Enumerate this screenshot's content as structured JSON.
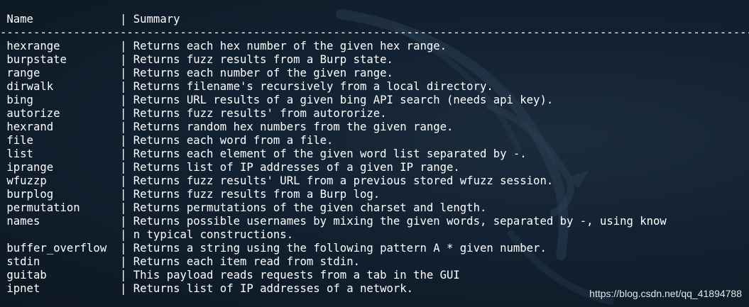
{
  "terminal": {
    "lines": [
      " Name             | Summary",
      "-----------------------------------------------------------------------------------------------------------------------",
      " hexrange         | Returns each hex number of the given hex range.",
      " burpstate        | Returns fuzz results from a Burp state.",
      " range            | Returns each number of the given range.",
      " dirwalk          | Returns filename's recursively from a local directory.",
      " bing             | Returns URL results of a given bing API search (needs api key).",
      " autorize         | Returns fuzz results' from autororize.",
      " hexrand          | Returns random hex numbers from the given range.",
      " file             | Returns each word from a file.",
      " list             | Returns each element of the given word list separated by -.",
      " iprange          | Returns list of IP addresses of a given IP range.",
      " wfuzzp           | Returns fuzz results' URL from a previous stored wfuzz session.",
      " burplog          | Returns fuzz results from a Burp log.",
      " permutation      | Returns permutations of the given charset and length.",
      " names            | Returns possible usernames by mixing the given words, separated by -, using know",
      "                  | n typical constructions.",
      " buffer_overflow  | Returns a string using the following pattern A * given number.",
      " stdin            | Returns each item read from stdin.",
      " guitab           | This payload reads requests from a tab in the GUI",
      " ipnet            | Returns list of IP addresses of a network."
    ]
  },
  "watermark": "https://blog.csdn.net/qq_41894788",
  "colors": {
    "background": "#0f1a26",
    "text": "#ffffff"
  }
}
